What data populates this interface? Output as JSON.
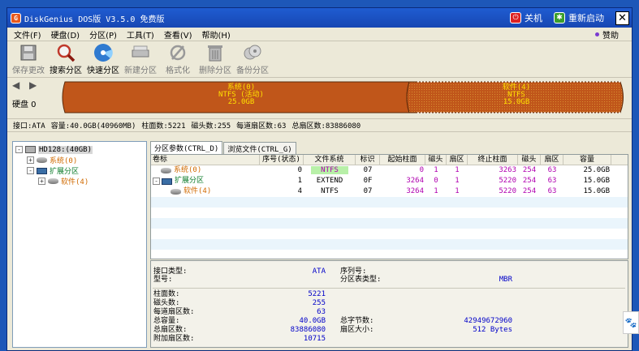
{
  "titlebar": {
    "title": "DiskGenius DOS版 V3.5.0 免费版",
    "app_icon_letter": "G",
    "shutdown_label": "关机",
    "restart_label": "重新启动",
    "close_glyph": "✕"
  },
  "menu": {
    "items": [
      "文件(F)",
      "硬盘(D)",
      "分区(P)",
      "工具(T)",
      "查看(V)",
      "帮助(H)"
    ],
    "help_label": "赞助"
  },
  "toolbar": {
    "save": "保存更改",
    "search": "搜索分区",
    "quick": "快速分区",
    "new": "新建分区",
    "format": "格式化",
    "delete": "删除分区",
    "backup": "备份分区"
  },
  "diskbar": {
    "nav": "◀ ▶",
    "disk_label": "硬盘 0",
    "partitions": [
      {
        "name": "系统(0)",
        "fs": "NTFS (活动)",
        "size": "25.0GB"
      },
      {
        "name": "软件(4)",
        "fs": "NTFS",
        "size": "15.0GB"
      }
    ],
    "colors": {
      "system": "#c0561a",
      "software": "#c0561a",
      "label": "#ffe000"
    }
  },
  "info": {
    "iface": "接口:ATA",
    "capacity": "容量:40.0GB(40960MB)",
    "cylinders": "柱面数:5221",
    "heads": "磁头数:255",
    "sectors_per_track": "每道扇区数:63",
    "total_sectors": "总扇区数:83886080"
  },
  "tree": {
    "root": "HD128:(40GB)",
    "items": [
      {
        "label": "系统(0)",
        "expander": "+"
      },
      {
        "label": "扩展分区",
        "expander": "-"
      },
      {
        "label": "软件(4)",
        "expander": "+"
      }
    ],
    "root_expander": "-"
  },
  "tabs": [
    "分区参数(CTRL_D)",
    "浏览文件(CTRL_G)"
  ],
  "grid": {
    "headers": [
      "卷标",
      "序号(状态)",
      "文件系统",
      "标识",
      "起始柱面",
      "磁头",
      "扇区",
      "终止柱面",
      "磁头",
      "扇区",
      "容量"
    ],
    "rows": [
      {
        "label": "系统(0)",
        "seq": "0",
        "fs": "NTFS",
        "id": "07",
        "start_cyl": "0",
        "start_head": "1",
        "start_sec": "1",
        "end_cyl": "3263",
        "end_head": "254",
        "end_sec": "63",
        "size": "25.0GB"
      },
      {
        "label": "扩展分区",
        "seq": "1",
        "fs": "EXTEND",
        "id": "0F",
        "start_cyl": "3264",
        "start_head": "0",
        "start_sec": "1",
        "end_cyl": "5220",
        "end_head": "254",
        "end_sec": "63",
        "size": "15.0GB"
      },
      {
        "label": "软件(4)",
        "seq": "4",
        "fs": "NTFS",
        "id": "07",
        "start_cyl": "3264",
        "start_head": "1",
        "start_sec": "1",
        "end_cyl": "5220",
        "end_head": "254",
        "end_sec": "63",
        "size": "15.0GB"
      }
    ]
  },
  "details": {
    "iface_type_label": "接口类型:",
    "iface_type_value": "ATA",
    "model_label": "型号:",
    "serial_label": "序列号:",
    "ptable_label": "分区表类型:",
    "ptable_value": "MBR",
    "cyl_label": "柱面数:",
    "cyl_value": "5221",
    "heads_label": "磁头数:",
    "heads_value": "255",
    "spt_label": "每道扇区数:",
    "spt_value": "63",
    "cap_label": "总容量:",
    "cap_value": "40.0GB",
    "bytes_label": "总字节数:",
    "bytes_value": "42949672960",
    "sectors_label": "总扇区数:",
    "sectors_value": "83886080",
    "secsize_label": "扇区大小:",
    "secsize_value": "512 Bytes",
    "extra_label": "附加扇区数:",
    "extra_value": "10715"
  },
  "side": {
    "paw_icon": "🐾"
  }
}
